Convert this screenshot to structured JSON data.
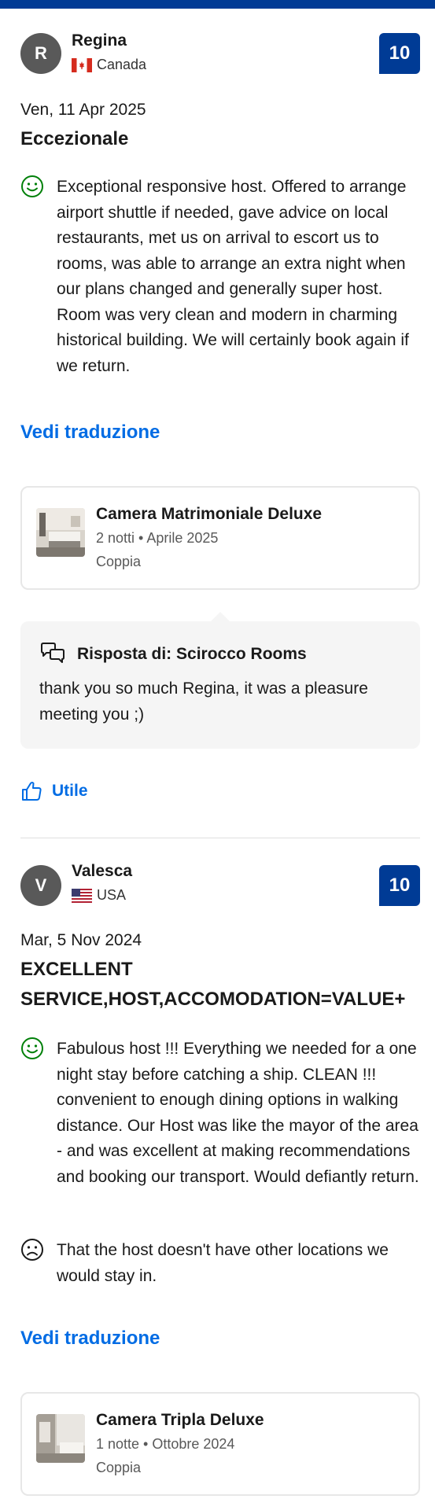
{
  "colors": {
    "brand": "#003b95",
    "link": "#006ce4",
    "positive": "#008009"
  },
  "reviews": [
    {
      "initial": "R",
      "name": "Regina",
      "country": "Canada",
      "flag": "canada-flag",
      "score": "10",
      "date": "Ven, 11 Apr 2025",
      "title": "Eccezionale",
      "positive": "Exceptional responsive host. Offered to arrange airport shuttle if needed, gave advice on local restaurants, met us on arrival to escort us to rooms, was able to arrange an extra night when our plans changed and generally super host. Room was very clean and modern in charming historical building. We will certainly book again if we return.",
      "translate_link": "Vedi traduzione",
      "room": {
        "name": "Camera Matrimoniale Deluxe",
        "meta": "2 notti • Aprile 2025",
        "type": "Coppia"
      },
      "response": {
        "title": "Risposta di: Scirocco Rooms",
        "text": "thank you so much Regina, it was a pleasure meeting you ;)"
      },
      "helpful": "Utile"
    },
    {
      "initial": "V",
      "name": "Valesca",
      "country": "USA",
      "flag": "usa-flag",
      "score": "10",
      "date": "Mar, 5 Nov 2024",
      "title": "EXCELLENT SERVICE,HOST,ACCOMODATION=VALUE+",
      "positive": "Fabulous host !!! Everything we needed for a one night stay before catching a ship. CLEAN !!! convenient to enough dining options in walking distance. Our Host was like the mayor of the area - and was excellent at making recommendations and booking our transport. Would defiantly return.",
      "negative": "That the host doesn't have other locations we would stay in.",
      "translate_link": "Vedi traduzione",
      "room": {
        "name": "Camera Tripla Deluxe",
        "meta": "1 notte • Ottobre 2024",
        "type": "Coppia"
      }
    }
  ]
}
